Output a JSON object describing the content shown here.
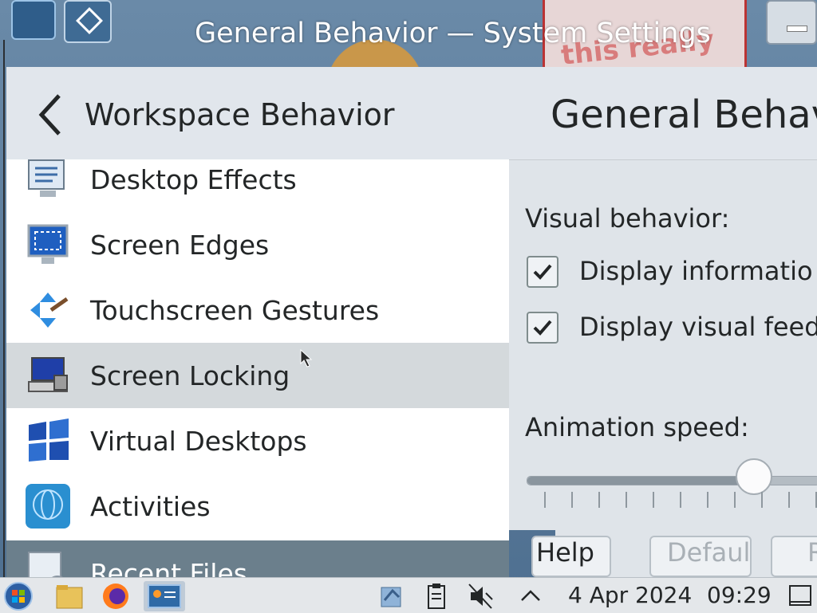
{
  "window": {
    "title": "General Behavior — System Settings"
  },
  "header": {
    "back_title": "Workspace Behavior",
    "page_title": "General Behav"
  },
  "sidebar": {
    "items": [
      {
        "label": "Desktop Effects",
        "icon": "desktop-effects-icon"
      },
      {
        "label": "Screen Edges",
        "icon": "screen-edges-icon"
      },
      {
        "label": "Touchscreen Gestures",
        "icon": "touchscreen-gestures-icon"
      },
      {
        "label": "Screen Locking",
        "icon": "screen-locking-icon",
        "selected": true
      },
      {
        "label": "Virtual Desktops",
        "icon": "virtual-desktops-icon"
      },
      {
        "label": "Activities",
        "icon": "activities-icon"
      },
      {
        "label": "Recent Files",
        "icon": "recent-files-icon"
      }
    ]
  },
  "content": {
    "visual_behavior_label": "Visual behavior:",
    "checkbox1_label": "Display informatio",
    "checkbox1_checked": true,
    "checkbox2_label": "Display visual feed",
    "checkbox2_checked": true,
    "animation_speed_label": "Animation speed:",
    "animation_speed_fraction": 0.78
  },
  "buttons": {
    "help": "Help",
    "defaults": "Defaults",
    "reset": "Reset"
  },
  "taskbar": {
    "date": "4 Apr 2024",
    "time": "09:29"
  },
  "colors": {
    "selected_row": "#d4d9dc",
    "panel_bg": "#dfe4e9",
    "header_bg": "#e1e6ec"
  }
}
